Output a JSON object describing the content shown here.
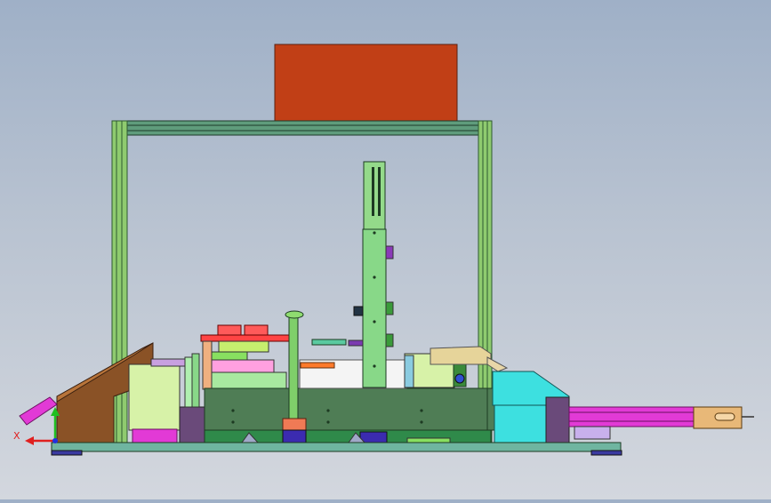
{
  "app": {
    "title": ""
  },
  "viewport": {
    "axis_triad": {
      "x_label": "X",
      "y_label": ""
    }
  },
  "colors": {
    "background_top": "#9fb0c7",
    "background_bottom": "#d3d7de",
    "frame_green": "#8fcb6f",
    "frame_dark": "#3b6e52",
    "housing_orange": "#c13f16",
    "chassis_green": "#4f7d55",
    "column_green": "#88d888",
    "magenta": "#e23ad6",
    "brown": "#8a5226",
    "cyan": "#3de0e0",
    "purple": "#3b2bb0",
    "axis_red": "#e02020",
    "axis_green": "#20c020",
    "axis_blue": "#2030e0"
  }
}
